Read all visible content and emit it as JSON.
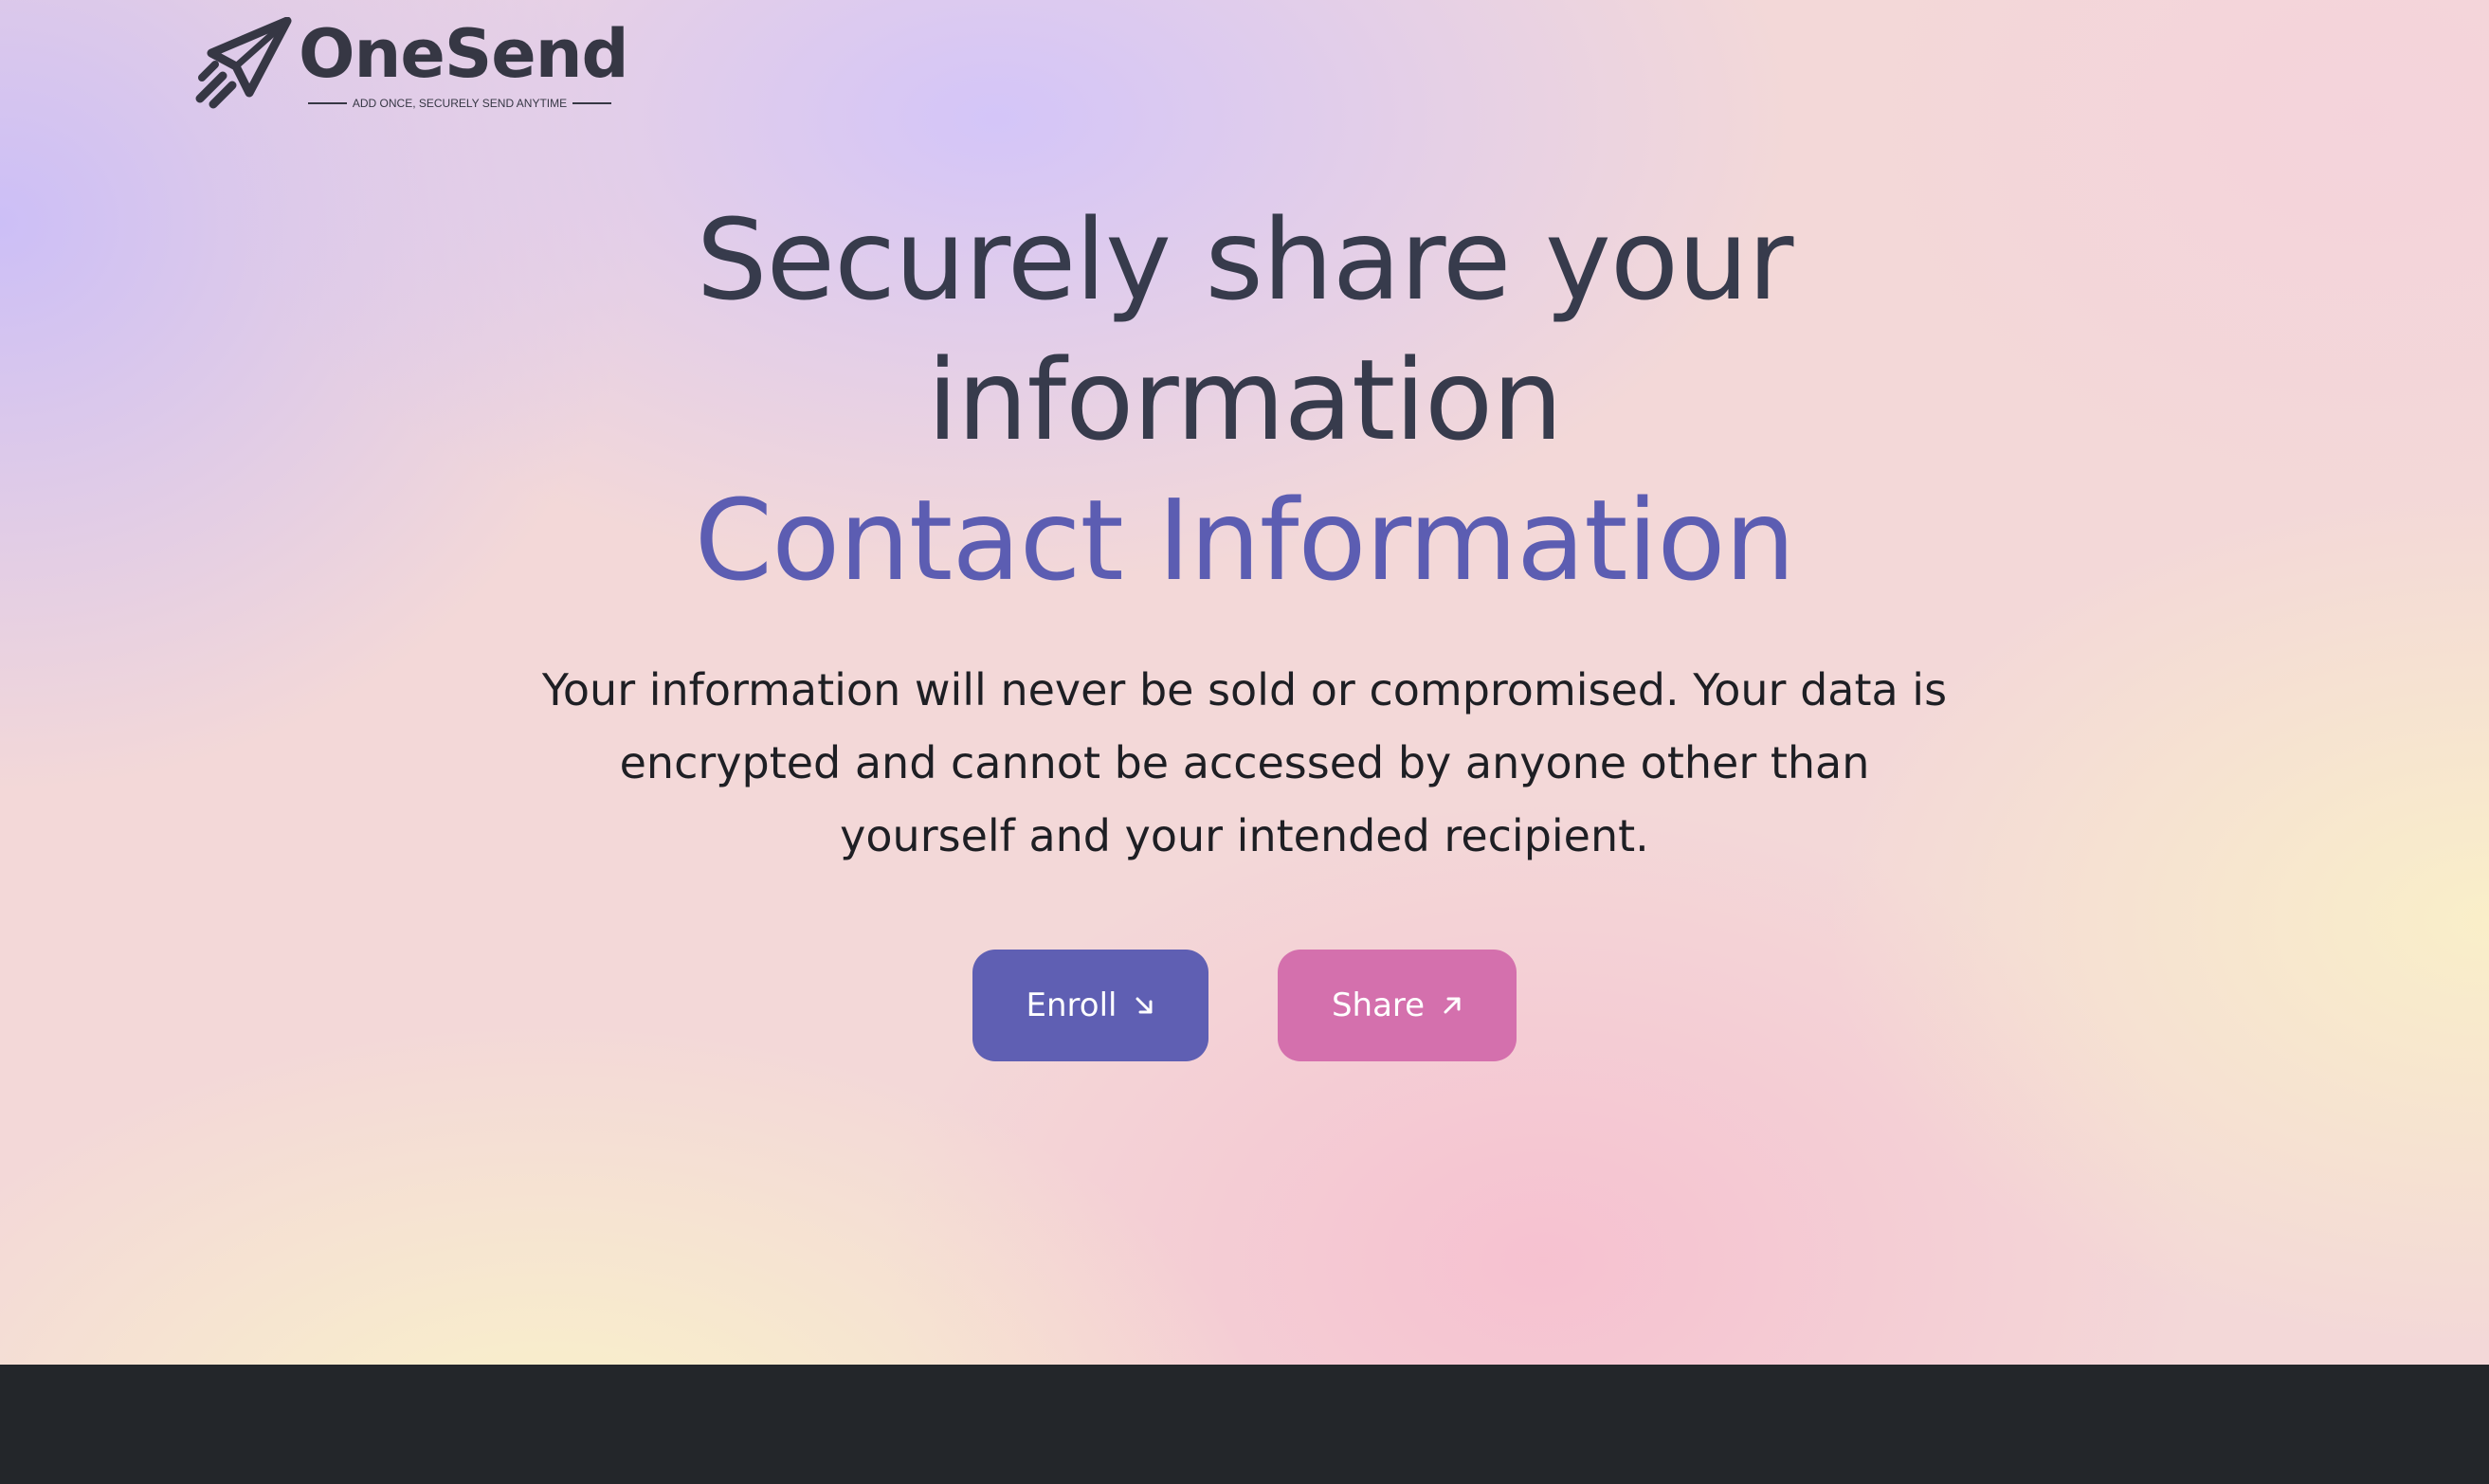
{
  "brand": {
    "name": "OneSend",
    "tagline": "ADD ONCE, SECURELY SEND ANYTIME",
    "icon": "paper-plane-icon",
    "color": "#363744"
  },
  "hero": {
    "title_line_1": "Securely share your",
    "title_line_2": "information",
    "title_highlight": "Contact Information",
    "description_line_1": "Your information will never be sold or compromised. Your data is",
    "description_line_2": "encrypted and cannot be accessed by anyone other than",
    "description_line_3": "yourself and your intended recipient."
  },
  "actions": {
    "enroll_label": "Enroll",
    "enroll_icon": "arrow-down-right-icon",
    "share_label": "Share",
    "share_icon": "arrow-up-right-icon"
  },
  "colors": {
    "headline": "#373b4c",
    "accent": "#5c5db2",
    "enroll_button": "#5f5fb3",
    "share_button": "#d470ad",
    "footer": "#23262a"
  }
}
